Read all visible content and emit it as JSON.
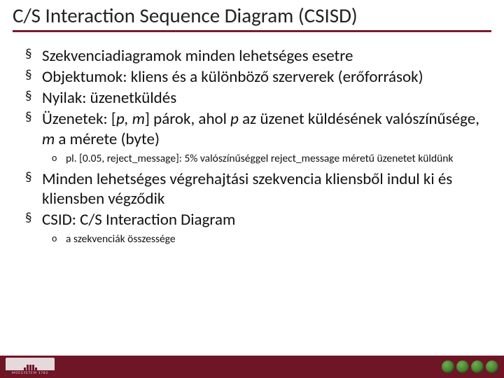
{
  "title": "C/S Interaction Sequence Diagram (CSISD)",
  "bullets": [
    {
      "text": "Szekvenciadiagramok minden lehetséges esetre"
    },
    {
      "text": "Objektumok: kliens és a különböző szerverek (erőforrások)"
    },
    {
      "text": "Nyilak: üzenetküldés"
    },
    {
      "html": "Üzenetek: [<span class='ital'>p, m</span>] párok, ahol <span class='ital'>p</span> az üzenet küldésének valószínűsége, <span class='ital'>m</span> a mérete (byte)",
      "sub": [
        {
          "text": "pl. [0.05, reject_message]: 5% valószínűséggel reject_message méretű üzenetet küldünk"
        }
      ]
    },
    {
      "text": "Minden lehetséges végrehajtási szekvencia kliensből indul ki és kliensben végződik"
    },
    {
      "text": "CSID: C/S Interaction Diagram",
      "sub": [
        {
          "text": "a szekvenciák összessége"
        }
      ]
    }
  ],
  "logo_text": "MŰEGYETEM 1782"
}
